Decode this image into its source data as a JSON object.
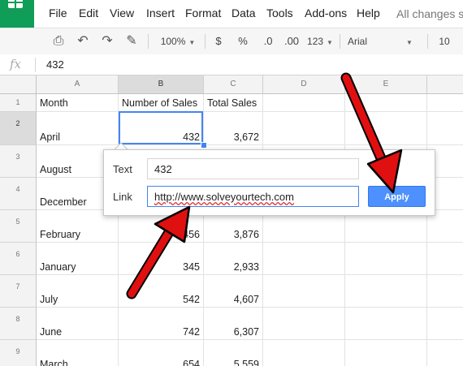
{
  "menu": [
    "File",
    "Edit",
    "View",
    "Insert",
    "Format",
    "Data",
    "Tools",
    "Add-ons",
    "Help"
  ],
  "status": "All changes s",
  "toolbar": {
    "zoom": "100%",
    "currency": "$",
    "percent": "%",
    "decimal_less": ".0",
    "decimal_more": ".00",
    "more_formats": "123",
    "font": "Arial",
    "font_size": "10"
  },
  "formula_bar": {
    "fx_label": "fx",
    "value": "432"
  },
  "columns": [
    "A",
    "B",
    "C",
    "D",
    "E"
  ],
  "rows": [
    "1",
    "2",
    "3",
    "4",
    "5",
    "6",
    "7",
    "8",
    "9"
  ],
  "cells": {
    "headers": [
      "Month",
      "Number of Sales",
      "Total Sales"
    ],
    "data": [
      {
        "month": "April",
        "num": "432",
        "total": "3,672"
      },
      {
        "month": "August",
        "num": "",
        "total": ""
      },
      {
        "month": "December",
        "num": "",
        "total": ""
      },
      {
        "month": "February",
        "num": "456",
        "total": "3,876"
      },
      {
        "month": "January",
        "num": "345",
        "total": "2,933"
      },
      {
        "month": "July",
        "num": "542",
        "total": "4,607"
      },
      {
        "month": "June",
        "num": "742",
        "total": "6,307"
      },
      {
        "month": "March",
        "num": "654",
        "total": "5,559"
      }
    ]
  },
  "link_dialog": {
    "text_label": "Text",
    "text_value": "432",
    "link_label": "Link",
    "link_value": "http://www.solveyourtech.com",
    "apply_label": "Apply"
  },
  "colors": {
    "accent": "#4285f4",
    "apply": "#4d90fe",
    "arrow": "#e01010",
    "logo": "#0f9d58"
  }
}
